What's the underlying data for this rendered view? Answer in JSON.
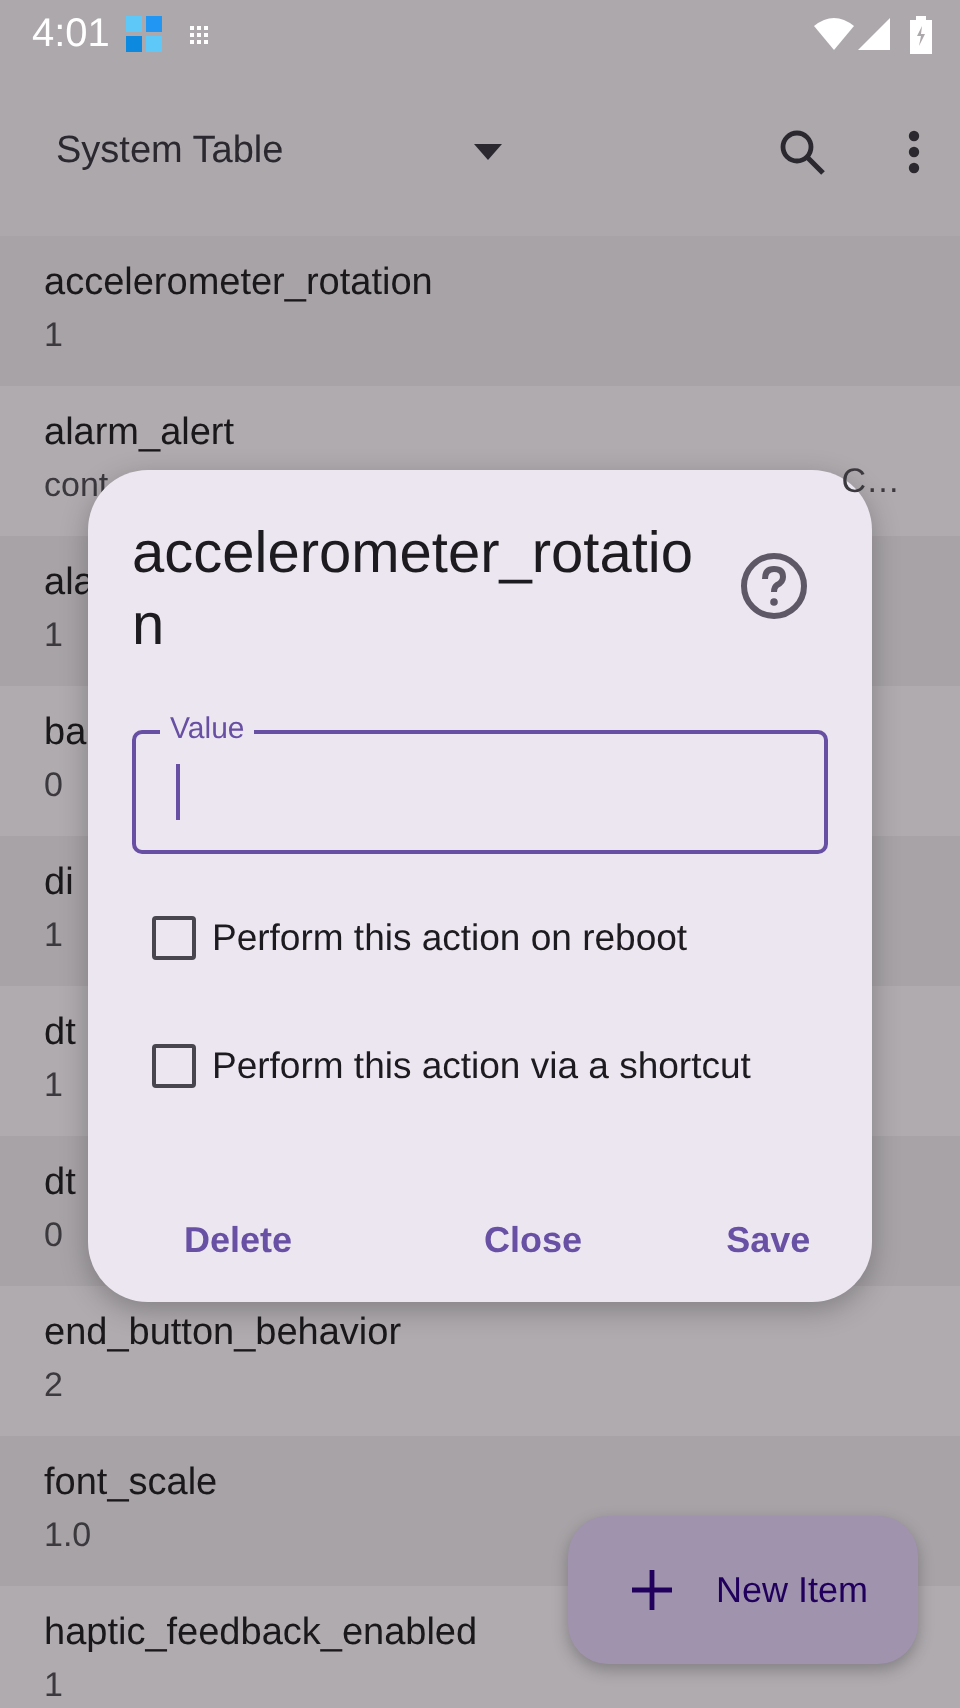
{
  "status_bar": {
    "time": "4:01"
  },
  "app_bar": {
    "title": "System Table"
  },
  "rows": [
    {
      "name": "accelerometer_rotation",
      "value": "1"
    },
    {
      "name": "alarm_alert",
      "value": "cont",
      "value_tail": "C…"
    },
    {
      "name": "ala",
      "value": "1"
    },
    {
      "name": "ba",
      "value": "0"
    },
    {
      "name": "di",
      "value": "1"
    },
    {
      "name": "dt",
      "value": "1"
    },
    {
      "name": "dt",
      "value": "0"
    },
    {
      "name": "end_button_behavior",
      "value": "2"
    },
    {
      "name": "font_scale",
      "value": "1.0"
    },
    {
      "name": "haptic_feedback_enabled",
      "value": "1"
    }
  ],
  "dialog": {
    "title": "accelerometer_rotation",
    "field": {
      "label": "Value"
    },
    "checkboxes": [
      {
        "label": "Perform this action on reboot",
        "checked": false
      },
      {
        "label": "Perform this action via a shortcut",
        "checked": false
      }
    ],
    "buttons": [
      {
        "label": "Delete"
      },
      {
        "label": "Close"
      },
      {
        "label": "Save"
      }
    ]
  },
  "fab": {
    "label": "New Item"
  }
}
